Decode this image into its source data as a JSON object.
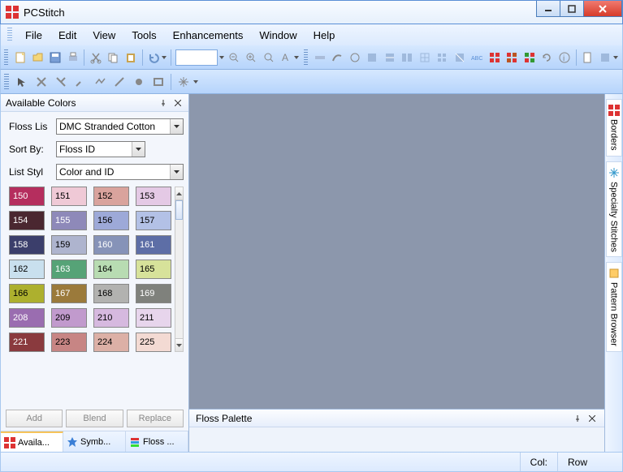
{
  "app": {
    "title": "PCStitch"
  },
  "menu": [
    "File",
    "Edit",
    "View",
    "Tools",
    "Enhancements",
    "Window",
    "Help"
  ],
  "panel": {
    "title": "Available Colors",
    "floss_list_label": "Floss Lis",
    "floss_list_value": "DMC Stranded Cotton",
    "sort_by_label": "Sort By:",
    "sort_by_value": "Floss ID",
    "list_style_label": "List Styl",
    "list_style_value": "Color and ID",
    "buttons": {
      "add": "Add",
      "blend": "Blend",
      "replace": "Replace"
    },
    "tabs": [
      "Availa...",
      "Symb...",
      "Floss ..."
    ]
  },
  "swatches": [
    {
      "id": "150",
      "bg": "#b52e5e",
      "fg": "#fff"
    },
    {
      "id": "151",
      "bg": "#efc9d6",
      "fg": "#000"
    },
    {
      "id": "152",
      "bg": "#d9a39d",
      "fg": "#000"
    },
    {
      "id": "153",
      "bg": "#e4c9e5",
      "fg": "#000"
    },
    {
      "id": "154",
      "bg": "#4a2730",
      "fg": "#fff"
    },
    {
      "id": "155",
      "bg": "#8e89b9",
      "fg": "#fff"
    },
    {
      "id": "156",
      "bg": "#9da9d8",
      "fg": "#000"
    },
    {
      "id": "157",
      "bg": "#b3c1e6",
      "fg": "#000"
    },
    {
      "id": "158",
      "bg": "#3b3e6b",
      "fg": "#fff"
    },
    {
      "id": "159",
      "bg": "#aeb4ce",
      "fg": "#000"
    },
    {
      "id": "160",
      "bg": "#8693b8",
      "fg": "#fff"
    },
    {
      "id": "161",
      "bg": "#5d6ea6",
      "fg": "#fff"
    },
    {
      "id": "162",
      "bg": "#c9e0ee",
      "fg": "#000"
    },
    {
      "id": "163",
      "bg": "#56a377",
      "fg": "#fff"
    },
    {
      "id": "164",
      "bg": "#b8dcb2",
      "fg": "#000"
    },
    {
      "id": "165",
      "bg": "#d7e29a",
      "fg": "#000"
    },
    {
      "id": "166",
      "bg": "#adb02e",
      "fg": "#000"
    },
    {
      "id": "167",
      "bg": "#9b7a3b",
      "fg": "#fff"
    },
    {
      "id": "168",
      "bg": "#b2b2b0",
      "fg": "#000"
    },
    {
      "id": "169",
      "bg": "#7f817c",
      "fg": "#fff"
    },
    {
      "id": "208",
      "bg": "#9a6db0",
      "fg": "#fff"
    },
    {
      "id": "209",
      "bg": "#c19acd",
      "fg": "#000"
    },
    {
      "id": "210",
      "bg": "#d6b9df",
      "fg": "#000"
    },
    {
      "id": "211",
      "bg": "#e7d5ec",
      "fg": "#000"
    },
    {
      "id": "221",
      "bg": "#8a3a3e",
      "fg": "#fff"
    },
    {
      "id": "223",
      "bg": "#c78584",
      "fg": "#000"
    },
    {
      "id": "224",
      "bg": "#dcb0a6",
      "fg": "#000"
    },
    {
      "id": "225",
      "bg": "#f3dad3",
      "fg": "#000"
    }
  ],
  "floss_palette": {
    "title": "Floss Palette"
  },
  "right_tabs": [
    "Borders",
    "Specialty Stitches",
    "Pattern Browser"
  ],
  "status": {
    "col": "Col:",
    "row": "Row"
  }
}
